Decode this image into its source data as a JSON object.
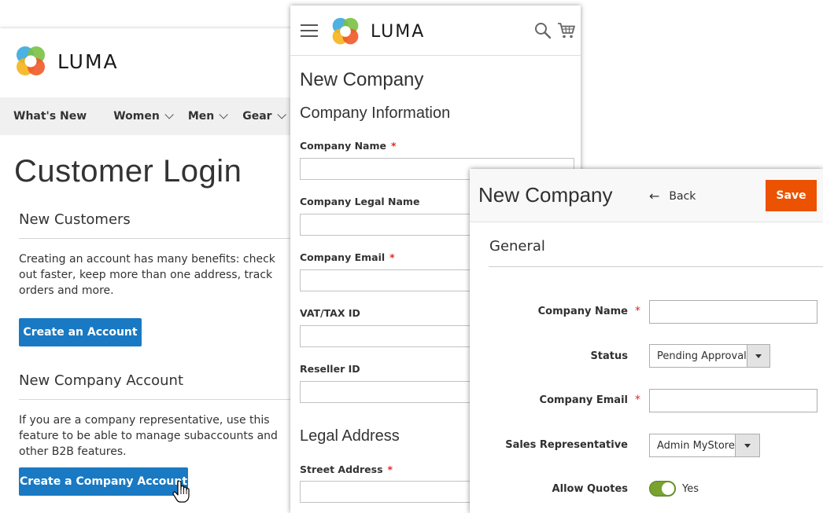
{
  "brand": {
    "name": "LUMA"
  },
  "storefront": {
    "nav": [
      {
        "label": "What's New",
        "has_dropdown": false
      },
      {
        "label": "Women",
        "has_dropdown": true
      },
      {
        "label": "Men",
        "has_dropdown": true
      },
      {
        "label": "Gear",
        "has_dropdown": true
      }
    ],
    "page_title": "Customer Login",
    "new_customers": {
      "title": "New Customers",
      "text": "Creating an account has many benefits: check out faster, keep more than one address, track orders and more.",
      "button": "Create an Account"
    },
    "new_company": {
      "title": "New Company Account",
      "text": "If you are a company representative, use this feature to be able to manage subaccounts and other B2B features.",
      "button": "Create a Company Account"
    }
  },
  "mobile_form": {
    "page_title": "New Company",
    "section_company": "Company Information",
    "fields": [
      {
        "label": "Company Name",
        "required": true
      },
      {
        "label": "Company Legal Name",
        "required": false
      },
      {
        "label": "Company Email",
        "required": true
      },
      {
        "label": "VAT/TAX ID",
        "required": false
      },
      {
        "label": "Reseller ID",
        "required": false
      }
    ],
    "section_address": "Legal Address",
    "address_fields": [
      {
        "label": "Street Address",
        "required": true
      }
    ],
    "required_marker": "*"
  },
  "admin_form": {
    "page_title": "New Company",
    "back_label": "Back",
    "save_label": "Save",
    "section": "General",
    "required_marker": "*",
    "fields": {
      "company_name": {
        "label": "Company Name",
        "value": ""
      },
      "status": {
        "label": "Status",
        "value": "Pending Approval"
      },
      "company_email": {
        "label": "Company Email",
        "value": ""
      },
      "sales_rep": {
        "label": "Sales Representative",
        "value": "Admin MyStore"
      },
      "allow_quotes": {
        "label": "Allow Quotes",
        "value": "Yes",
        "on": true
      }
    }
  },
  "colors": {
    "primary_blue": "#1979c3",
    "admin_orange": "#eb5202",
    "toggle_green": "#79a22e",
    "required_red": "#e02b27"
  },
  "icons": [
    "luma-logo-icon",
    "hamburger-icon",
    "search-icon",
    "cart-icon",
    "back-arrow-icon",
    "chevron-down-icon",
    "hand-pointer-cursor-icon"
  ]
}
